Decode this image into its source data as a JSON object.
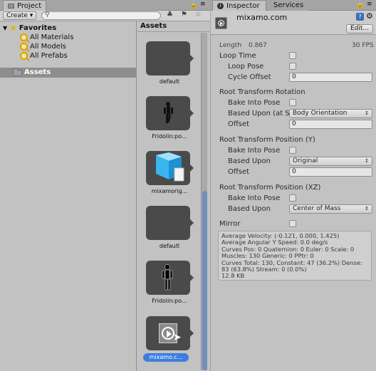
{
  "project": {
    "tab_label": "Project",
    "create_label": "Create ▾",
    "search_placeholder": "",
    "favorites_label": "Favorites",
    "favorites": [
      "All Materials",
      "All Models",
      "All Prefabs"
    ],
    "assets_root_label": "Assets"
  },
  "assets_pane": {
    "header": "Assets",
    "items": [
      {
        "label": "default"
      },
      {
        "label": "Fridolin:po..."
      },
      {
        "label": "mixamorig..."
      },
      {
        "label": "default"
      },
      {
        "label": "Fridolin:po..."
      },
      {
        "label": "mixamo.c..."
      }
    ]
  },
  "inspector": {
    "tabs": [
      "Inspector",
      "Services"
    ],
    "title": "mixamo.com",
    "edit_label": "Edit...",
    "length_label": "Length",
    "length_value": "0.867",
    "fps_value": "30 FPS",
    "loop_time": "Loop Time",
    "loop_pose": "Loop Pose",
    "cycle_offset": "Cycle Offset",
    "cycle_offset_value": "0",
    "rtr_header": "Root Transform Rotation",
    "rtr_bake": "Bake Into Pose",
    "rtr_based": "Based Upon (at St",
    "rtr_based_value": "Body Orientation",
    "rtr_offset": "Offset",
    "rtr_offset_value": "0",
    "rty_header": "Root Transform Position (Y)",
    "rty_bake": "Bake Into Pose",
    "rty_based": "Based Upon",
    "rty_based_value": "Original",
    "rty_offset": "Offset",
    "rty_offset_value": "0",
    "rtxz_header": "Root Transform Position (XZ)",
    "rtxz_bake": "Bake Into Pose",
    "rtxz_based": "Based Upon",
    "rtxz_based_value": "Center of Mass",
    "mirror": "Mirror",
    "stats": [
      "Average Velocity: (-0.121, 0.000, 1.425)",
      "Average Angular Y Speed: 0.0 deg/s",
      "Curves Pos: 0 Quaternion: 0 Euler: 0 Scale: 0",
      "Muscles: 130 Generic: 0 PPtr: 0",
      "Curves Total: 130, Constant: 47 (36.2%) Dense:",
      "83 (63.8%) Stream: 0 (0.0%)",
      "12.8 KB"
    ]
  },
  "colors": {
    "panel": "#c2c2c2",
    "selection": "#3e7de0",
    "asset_tile": "#4a4a4a",
    "scrollbar": "#6f8fb8"
  }
}
